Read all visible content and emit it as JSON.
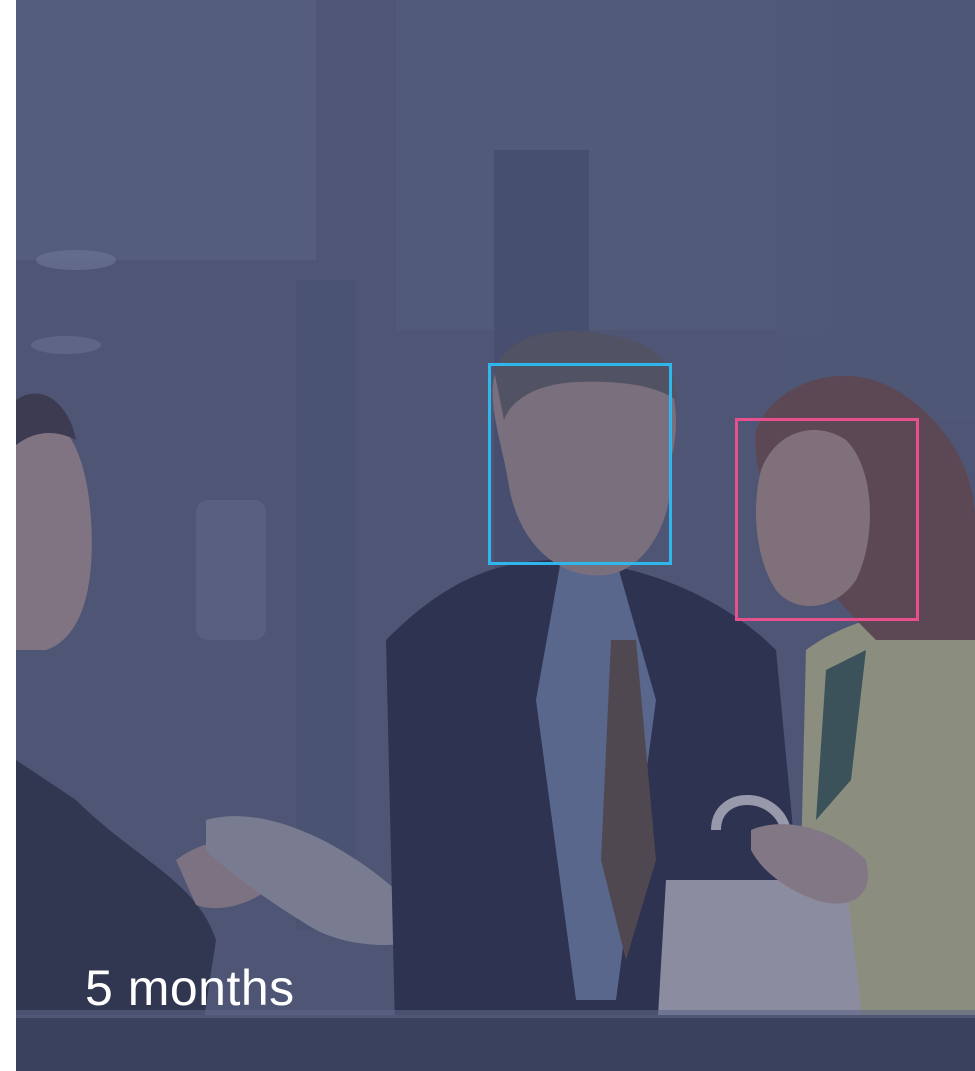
{
  "caption": "5 months",
  "colors": {
    "overlay": "#4b5270",
    "face_box_1": "#2fb6ea",
    "face_box_2": "#e8508d",
    "caption_text": "#ffffff"
  },
  "detections": [
    {
      "label_hidden": true,
      "color": "#2fb6ea",
      "subject": "man-face"
    },
    {
      "label_hidden": true,
      "color": "#e8508d",
      "subject": "woman-face"
    }
  ]
}
